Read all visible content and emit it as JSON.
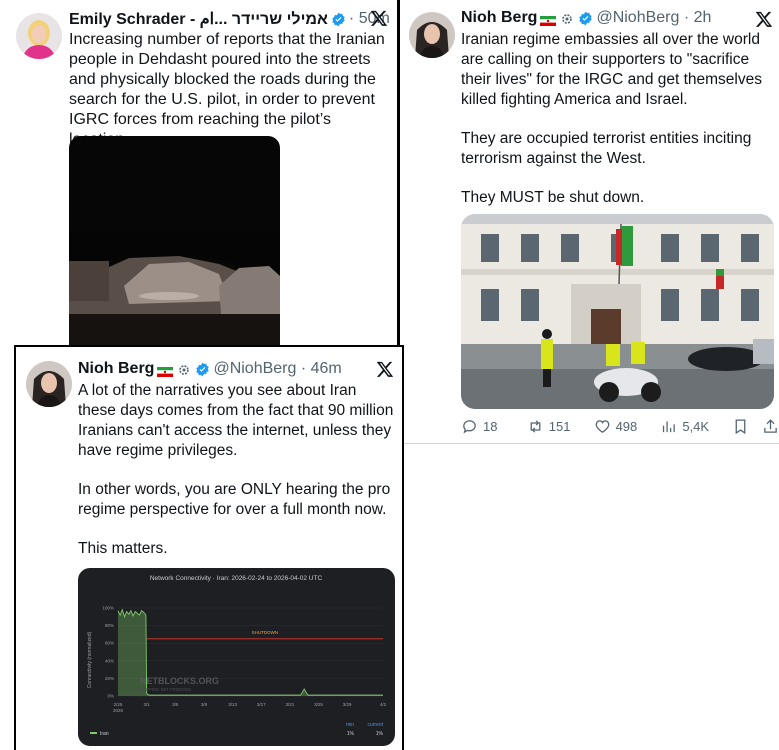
{
  "tweet1": {
    "name": "Emily Schrader - אמילי שריידר ...ام",
    "time": "50m",
    "text": "Increasing number of reports that the Iranian people in Dehdasht poured into the streets and physically blocked the roads during the search for the U.S. pilot, in order to prevent IGRC forces from reaching the pilot’s location."
  },
  "tweet2": {
    "name": "Nioh Berg",
    "handle": "@NiohBerg",
    "time": "2h",
    "paragraphs": [
      "Iranian regime embassies all over the world are calling on their supporters to \"sacrifice their lives\" for the IRGC and get themselves killed fighting America and Israel.",
      "They are occupied terrorist entities inciting terrorism against the West.",
      "They MUST be shut down."
    ],
    "actions": {
      "replies": "18",
      "reposts": "151",
      "likes": "498",
      "views": "5,4K"
    }
  },
  "tweet3": {
    "name": "Nioh Berg",
    "handle": "@NiohBerg",
    "time": "46m",
    "paragraphs": [
      "A lot of the narratives you see about Iran these days comes from the fact that 90 million Iranians can't access the internet, unless they have regime privileges.",
      "In other words, you are ONLY hearing the pro regime perspective for over a full month now.",
      "This matters."
    ]
  },
  "chart_data": {
    "type": "area",
    "title": "Network Connectivity · Iran: 2026-02-24 to 2026-04-02 UTC",
    "ylabel": "Connectivity (normalized)",
    "ylim": [
      0,
      100
    ],
    "y_ticks": [
      "0%",
      "20%",
      "40%",
      "60%",
      "80%",
      "100%"
    ],
    "x_ticks": [
      "2/25\n2026",
      "3/1",
      "3/5",
      "3/9",
      "3/13",
      "3/17",
      "3/21",
      "3/25",
      "3/29",
      "4/2"
    ],
    "annotation": "SHUTDOWN",
    "watermark": "NETBLOCKS.ORG",
    "watermark_sub": "MAPPING NET FREEDOM",
    "series": [
      {
        "name": "Iran",
        "color": "#7fc96a",
        "x": [
          0,
          0.3,
          0.6,
          0.9,
          1.2,
          1.5,
          1.8,
          2.1,
          2.4,
          2.7,
          3.0,
          3.3,
          3.6,
          3.9,
          4.0,
          4.3,
          8,
          12,
          16,
          20,
          24,
          25.5,
          26,
          26.5,
          28,
          32,
          36,
          37
        ],
        "y": [
          97,
          92,
          98,
          90,
          96,
          93,
          97,
          91,
          96,
          94,
          92,
          97,
          95,
          92,
          3,
          1,
          1,
          1,
          1,
          1,
          1,
          1,
          8,
          1,
          1,
          1,
          1,
          1
        ]
      }
    ],
    "stats_headers": [
      "min",
      "current"
    ],
    "stats_row": {
      "name": "Iran",
      "min": "1%",
      "current": "1%"
    }
  },
  "colors": {
    "verified": "#1d9bf0",
    "text_secondary": "#536471",
    "chart_bg": "#1e1f22",
    "shutdown_line": "#e0362c"
  }
}
